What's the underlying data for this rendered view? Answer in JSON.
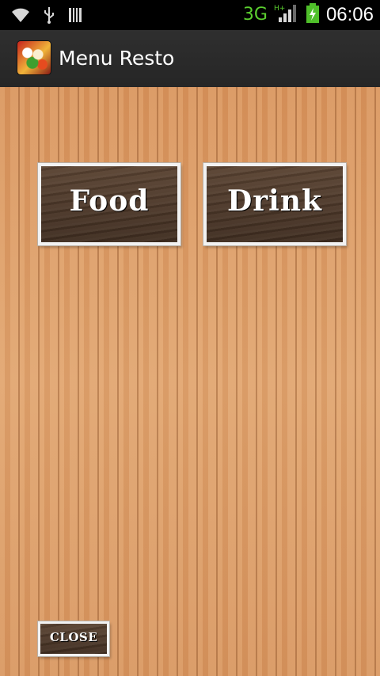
{
  "status_bar": {
    "icons": [
      "wifi-icon",
      "usb-icon",
      "sd-card-icon"
    ],
    "network": "3G",
    "signal": "H+",
    "clock": "06:06",
    "accent": "#5bcf2f"
  },
  "action_bar": {
    "app_icon": "food-app-icon",
    "title": "Menu Resto"
  },
  "main": {
    "food_label": "Food",
    "drink_label": "Drink",
    "close_label": "CLOSE"
  },
  "colors": {
    "wood_background": "#d99862",
    "button_wood": "#4a3526",
    "button_border": "#f2f2f2"
  }
}
